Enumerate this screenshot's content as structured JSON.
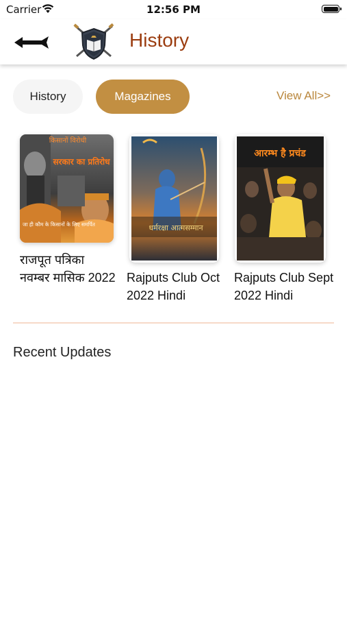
{
  "status_bar": {
    "carrier": "Carrier",
    "time": "12:56 PM"
  },
  "header": {
    "title": "History",
    "back_icon": "arrow-left-icon",
    "logo_icon": "crossed-swords-shield-icon"
  },
  "tabs": [
    {
      "label": "History",
      "active": false
    },
    {
      "label": "Magazines",
      "active": true
    }
  ],
  "view_all": "View All>>",
  "magazines": [
    {
      "title": "राजपूत पत्रिका नवम्बर मासिक 2022",
      "cover_text_top": "किसानों विरोधी",
      "cover_text_mid": "सरकार का प्रतिरोध",
      "cover_text_bottom": "जा ही कौम के किसानों के लिए समर्पित"
    },
    {
      "title": "Rajputs Club Oct 2022 Hindi",
      "cover_text": "धर्मरक्षा आत्मसम्मान"
    },
    {
      "title": "Rajputs Club Sept 2022 Hindi",
      "cover_text": "आरम्भ है प्रचंड"
    }
  ],
  "recent_updates_heading": "Recent Updates",
  "colors": {
    "accent": "#c28f42",
    "title": "#9b3d10",
    "link": "#b9863b",
    "divider": "#f7d9c8"
  }
}
